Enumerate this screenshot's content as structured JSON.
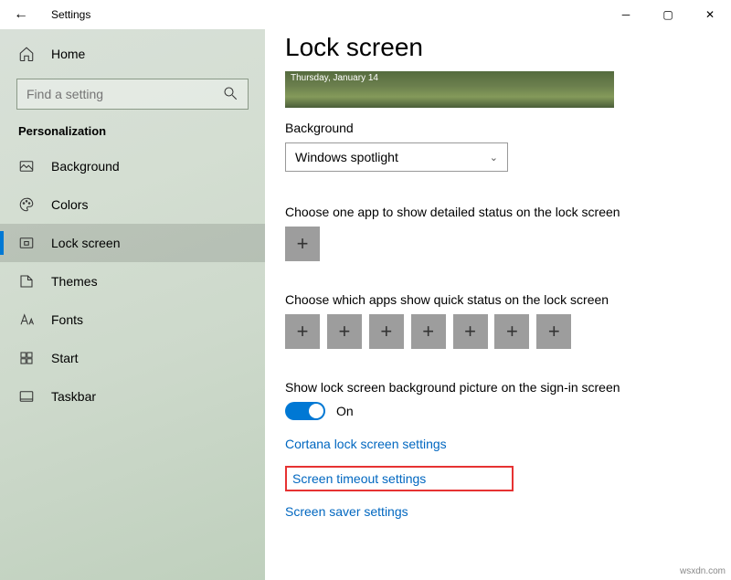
{
  "window": {
    "title": "Settings"
  },
  "sidebar": {
    "home": "Home",
    "search_placeholder": "Find a setting",
    "category": "Personalization",
    "items": [
      {
        "label": "Background"
      },
      {
        "label": "Colors"
      },
      {
        "label": "Lock screen"
      },
      {
        "label": "Themes"
      },
      {
        "label": "Fonts"
      },
      {
        "label": "Start"
      },
      {
        "label": "Taskbar"
      }
    ]
  },
  "content": {
    "title": "Lock screen",
    "preview_overlay": "Thursday, January 14",
    "background_label": "Background",
    "background_value": "Windows spotlight",
    "detailed_label": "Choose one app to show detailed status on the lock screen",
    "quick_label": "Choose which apps show quick status on the lock screen",
    "signin_label": "Show lock screen background picture on the sign-in screen",
    "signin_toggle": "On",
    "links": {
      "cortana": "Cortana lock screen settings",
      "timeout": "Screen timeout settings",
      "saver": "Screen saver settings"
    }
  },
  "watermark": "wsxdn.com"
}
